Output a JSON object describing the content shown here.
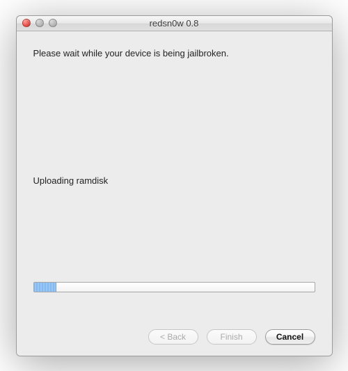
{
  "window": {
    "title": "redsn0w 0.8"
  },
  "content": {
    "main_message": "Please wait while your device is being jailbroken.",
    "status_message": "Uploading ramdisk"
  },
  "progress": {
    "percent": 8
  },
  "buttons": {
    "back_label": "< Back",
    "finish_label": "Finish",
    "cancel_label": "Cancel"
  }
}
